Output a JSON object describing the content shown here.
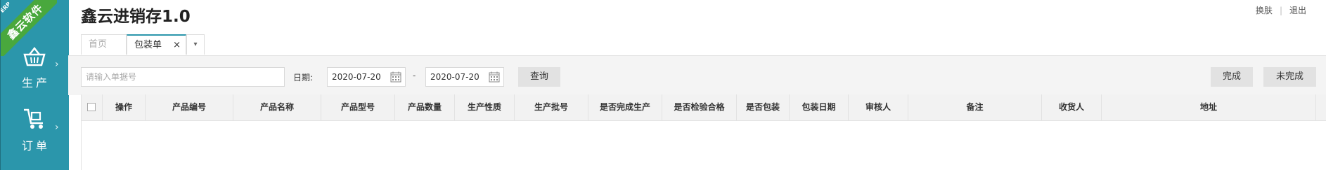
{
  "brand": {
    "ribbon_text": "鑫云软件",
    "ribbon_small": "ERP",
    "title": "鑫云进销存1.0"
  },
  "sidebar": {
    "items": [
      {
        "label": "生产",
        "icon": "basket-icon"
      },
      {
        "label": "订单",
        "icon": "cart-icon"
      }
    ],
    "accent": "#2b96ab",
    "ribbon_color": "#49a83d"
  },
  "top_links": {
    "skin": "换肤",
    "logout": "退出"
  },
  "tabs": {
    "home": "首页",
    "active": "包装单",
    "close_glyph": "×",
    "more_glyph": "▾"
  },
  "toolbar": {
    "order_placeholder": "请输入单据号",
    "date_label": "日期:",
    "date_start": "2020-07-20",
    "date_end": "2020-07-20",
    "range_dash": "-",
    "query_button": "查询",
    "done_button": "完成",
    "undone_button": "未完成"
  },
  "table": {
    "columns": [
      "操作",
      "产品编号",
      "产品名称",
      "产品型号",
      "产品数量",
      "生产性质",
      "生产批号",
      "是否完成生产",
      "是否检验合格",
      "是否包装",
      "包装日期",
      "审核人",
      "备注",
      "收货人",
      "地址"
    ],
    "rows": []
  }
}
